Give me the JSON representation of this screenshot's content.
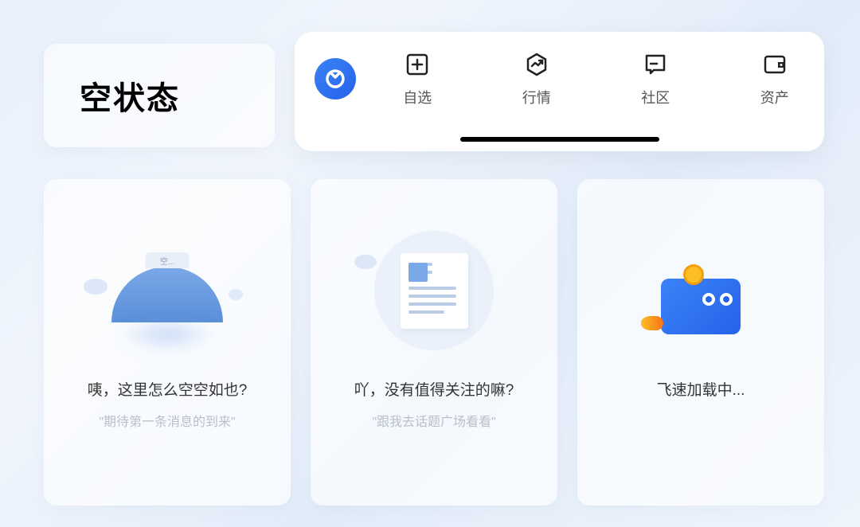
{
  "title": "空状态",
  "nav": {
    "items": [
      {
        "label": "自选",
        "icon": "plus-box"
      },
      {
        "label": "行情",
        "icon": "chart-hex"
      },
      {
        "label": "社区",
        "icon": "chat-box"
      },
      {
        "label": "资产",
        "icon": "wallet-box"
      }
    ]
  },
  "cards": [
    {
      "illustration_label": "空...",
      "title": "咦，这里怎么空空如也?",
      "subtitle": "\"期待第一条消息的到来\""
    },
    {
      "title": "吖，没有值得关注的嘛?",
      "subtitle": "\"跟我去话题广场看看\""
    },
    {
      "title": "飞速加载中...",
      "subtitle": ""
    }
  ]
}
